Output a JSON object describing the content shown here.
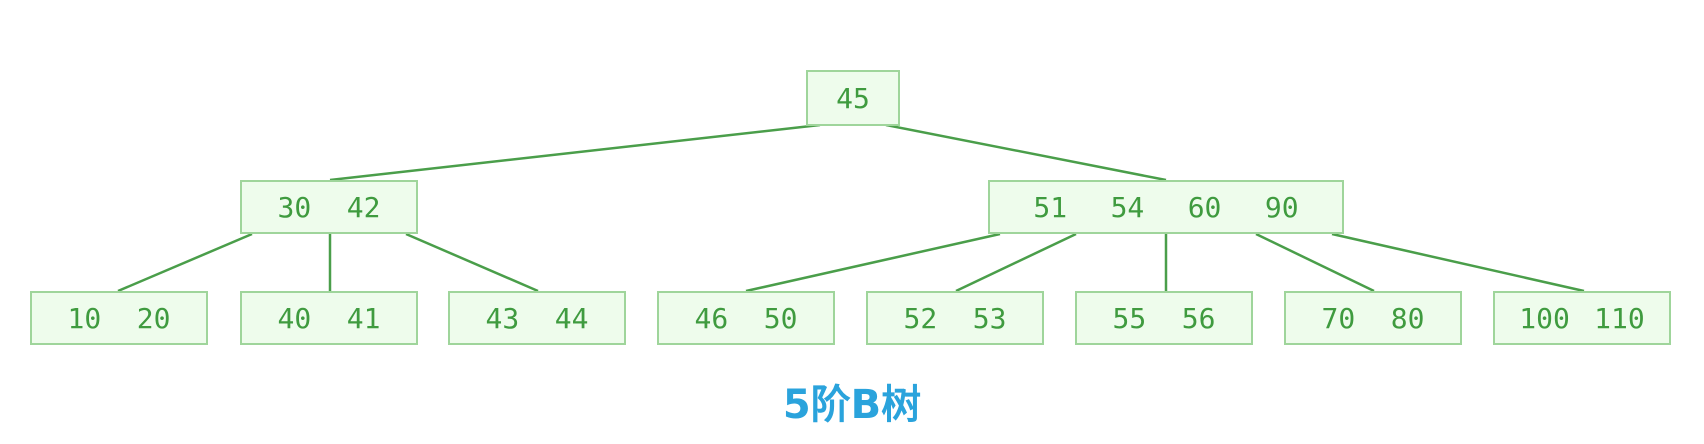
{
  "colors": {
    "node_fill": "#eefcec",
    "node_border": "#9fd59b",
    "key_text": "#3f9b3f",
    "edge": "#4a9e4a",
    "caption": "#2aa3dc"
  },
  "tree": {
    "root": [
      "45"
    ],
    "level1": [
      [
        "30",
        "42"
      ],
      [
        "51",
        "54",
        "60",
        "90"
      ]
    ],
    "level2": [
      [
        "10",
        "20"
      ],
      [
        "40",
        "41"
      ],
      [
        "43",
        "44"
      ],
      [
        "46",
        "50"
      ],
      [
        "52",
        "53"
      ],
      [
        "55",
        "56"
      ],
      [
        "70",
        "80"
      ],
      [
        "100",
        "110"
      ]
    ]
  },
  "caption": "5阶B树"
}
